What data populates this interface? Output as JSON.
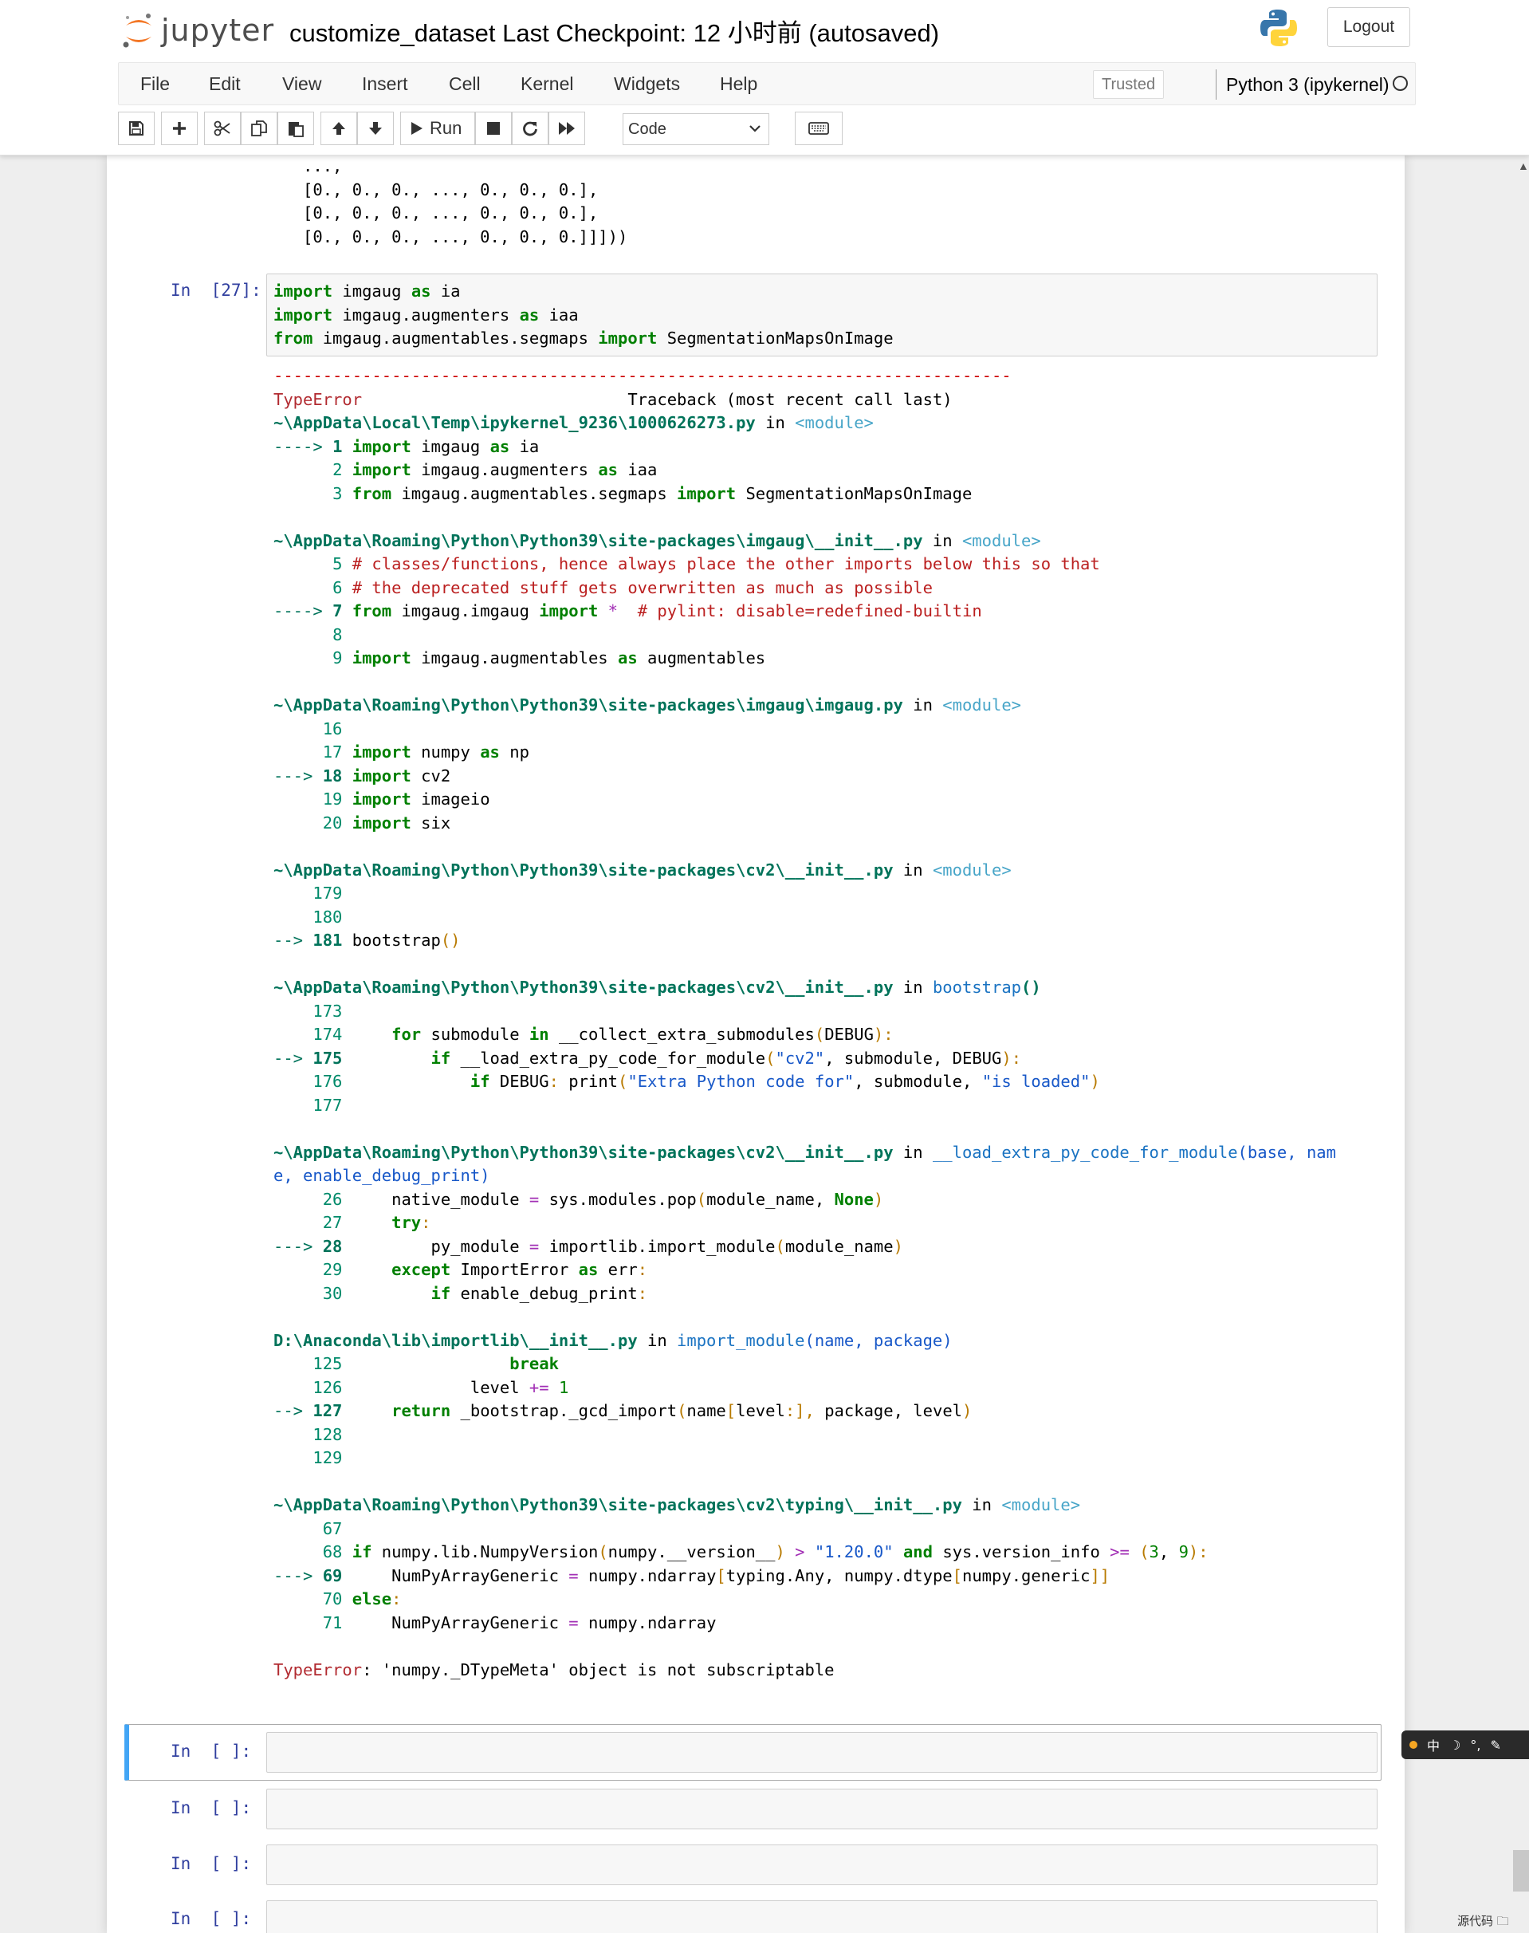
{
  "header": {
    "logo_text": "jupyter",
    "notebook_name": "customize_dataset",
    "checkpoint": "Last Checkpoint: 12 小时前",
    "autosave": "(autosaved)",
    "logout_label": "Logout"
  },
  "menu": {
    "items": [
      "File",
      "Edit",
      "View",
      "Insert",
      "Cell",
      "Kernel",
      "Widgets",
      "Help"
    ],
    "trusted_label": "Trusted",
    "kernel_name": "Python 3 (ipykernel)"
  },
  "toolbar": {
    "run_label": "Run",
    "cell_type": "Code",
    "icons": [
      "save-icon",
      "plus-icon",
      "scissors-icon",
      "copy-icon",
      "paste-icon",
      "arrow-up-icon",
      "arrow-down-icon",
      "play-icon",
      "stop-icon",
      "restart-icon",
      "fast-forward-icon",
      "keyboard-icon"
    ]
  },
  "prev_output": {
    "lines": [
      "   ...,",
      "   [0., 0., 0., ..., 0., 0., 0.],",
      "   [0., 0., 0., ..., 0., 0., 0.],",
      "   [0., 0., 0., ..., 0., 0., 0.]]]))"
    ]
  },
  "cell27": {
    "prompt": "In  [27]:",
    "code": [
      {
        "kw1": "import",
        "t1": " imgaug ",
        "kw2": "as",
        "t2": " ia"
      },
      {
        "kw1": "import",
        "t1": " imgaug.augmenters ",
        "kw2": "as",
        "t2": " iaa"
      },
      {
        "kw1": "from",
        "t1": " imgaug.augmentables.segmaps ",
        "kw2": "import",
        "t2": " SegmentationMapsOnImage"
      }
    ]
  },
  "traceback": {
    "dashes": "---------------------------------------------------------------------------",
    "error_name": "TypeError",
    "traceback_label": "Traceback (most recent call last)",
    "final_error_name": "TypeError",
    "final_error_msg": ": 'numpy._DTypeMeta' object is not subscriptable"
  },
  "empty_cells": {
    "prompt": "In  [ ]:"
  },
  "ime": {
    "lang": "中",
    "symbols": "°,",
    "corner": "源代码  🗀"
  }
}
